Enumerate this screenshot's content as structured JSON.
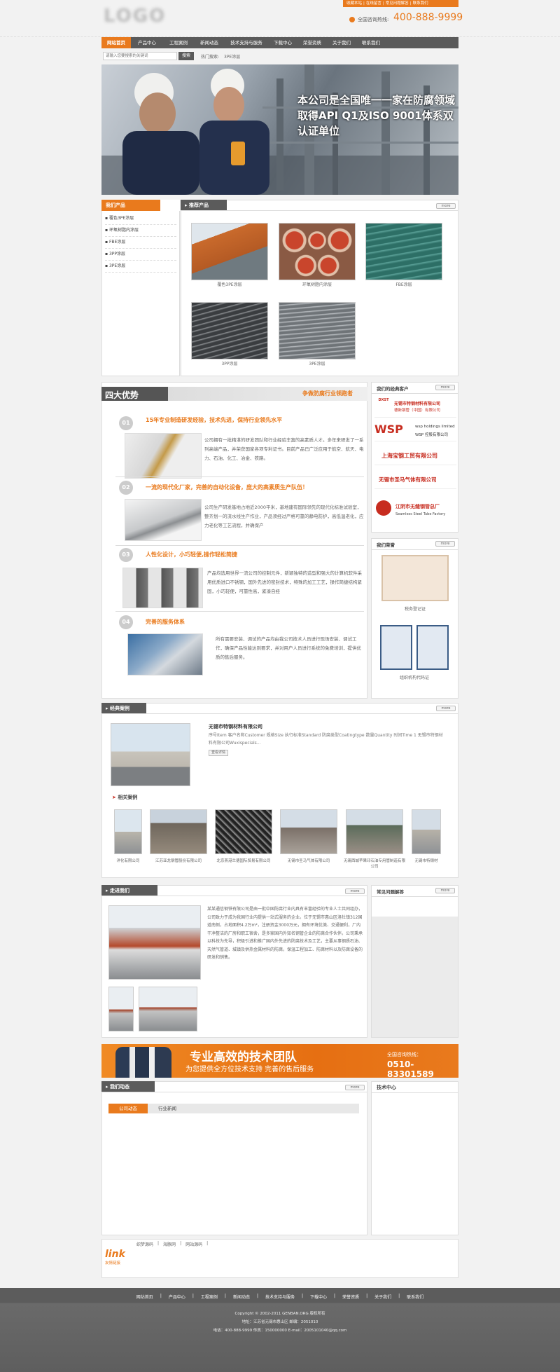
{
  "topbar": {
    "links": [
      "收藏本站",
      "在线留言",
      "常见问题解答",
      "联系我们"
    ],
    "logo": "LOGO",
    "hotline_label": "全国咨询热线:",
    "hotline": "400-888-9999"
  },
  "nav": [
    "网站首页",
    "产品中心",
    "工程案例",
    "新闻动态",
    "技术支持与服务",
    "下载中心",
    "荣誉资质",
    "关于我们",
    "联系我们"
  ],
  "search": {
    "placeholder": "请输入您要搜索的关键词",
    "button": "搜索",
    "hot_label": "热门搜索:",
    "hot_term": "3PE涂层"
  },
  "banner": {
    "line1": "本公司是全国唯一一家在防腐领域",
    "line2": "取得API Q1及ISO 9001体系双",
    "line3": "认证单位"
  },
  "products_sidebar": {
    "title": "我们产品",
    "items": [
      "覆色3PE涂层",
      "环氧树脂内涂层",
      "FBE涂层",
      "3PP涂层",
      "3PE涂层"
    ]
  },
  "recommended": {
    "title": "推荐产品",
    "more": "more",
    "items": [
      "覆色3PE涂层",
      "环氧树脂内涂层",
      "FBE涂层",
      "3PP涂层",
      "3PE涂层"
    ]
  },
  "advantages": {
    "title": "四大优势",
    "slogan": "争做防腐行业领跑者",
    "items": [
      {
        "num": "01",
        "heading": "15年专业制造研发经验，技术先进，保持行业领先水平",
        "text": "公司拥有一批精湛的研发团队和行业经验丰富的高素质人才。多年来研发了一系列高端产品，并荣获国家各项专利证书。目前产品已广泛应用于航空、航天、电力、石油、化工、冶金、铁路。"
      },
      {
        "num": "02",
        "heading": "一流的现代化厂家，完善的自动化设备，庞大的高素质生产队伍！",
        "text": "公司生产研发基地占地近2000平米，基地建有国际领先的现代化标准试验室，整齐划一的流水线生产作业，产品须经过严格可靠的静电防护，高低温老化，应力老化等工艺流程，并确保产"
      },
      {
        "num": "03",
        "heading": "人性化设计，小巧轻便,操作轻松简捷",
        "text": "产品均选用世界一流公司的控制元件，新颖独特的造型和强大的计算机软件采用优质进口不锈钢，国外先进的密封技术，特殊的加工工艺，操作简捷结构紧固，小巧轻便，可靠性高，紧凑自经"
      },
      {
        "num": "04",
        "heading": "完善的服务体系",
        "text": "所有需要安装、调试的产品均由我公司技术人员进行现场安装、调试工作，确保产品性能达到要求，并对用户人员进行系统的免费培训，提供优质的售后服务。"
      }
    ]
  },
  "clients": {
    "title": "我们的经典客户",
    "more": "more",
    "items": [
      {
        "name": "无锡市特钢材料有限公司",
        "sub": "德新钢管（中国）有限公司",
        "logo": "DXST"
      },
      {
        "name": "wsp holdings limited",
        "sub": "WSP 控股有限公司",
        "logo": "WSP"
      },
      {
        "name": "上海宝钢工贸有限公司",
        "sub": "",
        "logo": ""
      },
      {
        "name": "无锡市圣马气体有限公司",
        "sub": "",
        "logo": ""
      },
      {
        "name": "江阴市无缝钢管总厂",
        "sub": "Seamless Steel Tube Factory",
        "logo": ""
      }
    ]
  },
  "honors": {
    "title": "我们荣誉",
    "more": "more",
    "items": [
      "税务登记证",
      "组织机构代码证"
    ]
  },
  "cases": {
    "title": "经典案例",
    "more": "more",
    "featured_title": "无锡市特钢材料有限公司",
    "featured_text": "序号Item 客户名称Customer 规格Size 执行标准Standard 防腐类型Coatingtype 数量Quantity 时间Time 1 无锡市特钢材料有限公司Wuxispecials...",
    "detail_btn": "查看详情",
    "related_title": "相关案例",
    "related": [
      "洋化有限公司",
      "江苏亚龙钢管股份有限公司",
      "北京燕港兰德国际贸易有限公司",
      "无锡市圣马气体有限公司",
      "无锡西城苹果印石油专用管制造有限公司",
      "无锡市特钢材"
    ]
  },
  "about": {
    "title": "走进我们",
    "more": "more",
    "text": "某某通信钢铁有限公司是由一批中国防腐行业内具有丰富经验的专业人士共同组办，公司致力于成为我国行业内提供一站式服务的企业。位于无锡市惠山区洛社镇312国道南侧，占地面积4.2万m²，注册资金3000万元，拥有环境优美、交通便利，厂内干净整洁的厂房和职工宿舍，是多家国内外知名钢管企业的防腐合作伙伴。公司秉承以科技为先导，积极引进和推广国内外先进的防腐技术及工艺，主要从事钢质石油、天然气管道、城镇及供热金属材料的防腐，保温工程加工、防腐材料以及防腐设备的研发和销售。"
  },
  "faq": {
    "title": "常见问题解答",
    "more": "more"
  },
  "promo": {
    "headline": "专业高效的技术团队",
    "sub": "为您提供全方位技术支持 完善的售后服务",
    "hotline_label": "全国咨询热线：",
    "hotline": "0510-83301589"
  },
  "news": {
    "title": "我们动态",
    "more": "more",
    "tabs": [
      "公司动态",
      "行业新闻"
    ]
  },
  "tech": {
    "title": "技术中心"
  },
  "links": {
    "logo": "link",
    "logo_sub": "友情链接",
    "items": [
      "织梦源码",
      "海豚网",
      "网站源码"
    ]
  },
  "footer": {
    "nav": [
      "网站首页",
      "产品中心",
      "工程案例",
      "新闻动态",
      "技术支持与服务",
      "下载中心",
      "荣誉资质",
      "关于我们",
      "联系我们"
    ],
    "copyright": "Copyright © 2002-2011 GENBAN.ORG 版权所有",
    "address": "地址：江苏省无锡市惠山区 邮编：2051010",
    "contact": "电话：400-888-9999  传真：150000000  E-mail：2005101040@qq.com"
  },
  "colors": {
    "accent": "#e97a1d",
    "nav_bg": "#5a5a5a",
    "nav_active": "#e97a1d",
    "section_title_bg": "#5b5b5b",
    "footer_bg": "#5c5c5c"
  }
}
